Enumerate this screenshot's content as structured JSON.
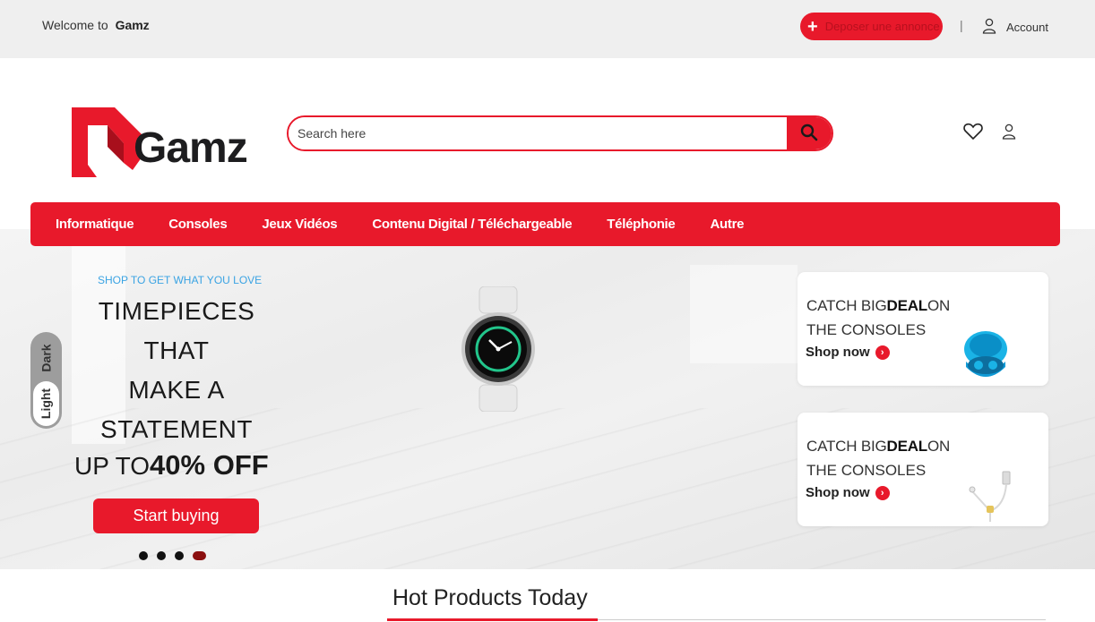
{
  "topbar": {
    "welcome_text": "Welcome to",
    "brand_name": "Gamz",
    "post_ad_label": "Deposer une annonce",
    "separator": "|",
    "account_label": "Account"
  },
  "header": {
    "logo_text": "Gamz",
    "search": {
      "placeholder": "Search here",
      "value": ""
    }
  },
  "nav": {
    "items": [
      {
        "label": "Informatique"
      },
      {
        "label": "Consoles"
      },
      {
        "label": "Jeux Vidéos"
      },
      {
        "label": "Contenu Digital / Téléchargeable"
      },
      {
        "label": "Téléphonie"
      },
      {
        "label": "Autre"
      }
    ]
  },
  "hero": {
    "tagline": "SHOP TO GET WHAT YOU LOVE",
    "headline_lines": [
      "TIMEPIECES",
      "THAT",
      "MAKE A",
      "STATEMENT"
    ],
    "discount_prefix": "UP TO",
    "discount_value": "40% OFF",
    "cta_label": "Start buying",
    "slides_count": 4,
    "active_slide": 4
  },
  "theme_toggle": {
    "dark_label": "Dark",
    "light_label": "Light",
    "selected": "Light"
  },
  "promos": [
    {
      "pre": "CATCH BIG",
      "bold": "DEAL",
      "post": "ON",
      "line2": "THE CONSOLES",
      "shop_label": "Shop now",
      "image": "earbuds-case"
    },
    {
      "pre": "CATCH BIG",
      "bold": "DEAL",
      "post": "ON",
      "line2": "THE CONSOLES",
      "shop_label": "Shop now",
      "image": "usb-earphones"
    }
  ],
  "section": {
    "title": "Hot Products Today"
  },
  "colors": {
    "accent": "#e8192b",
    "topbar_bg": "#efefef",
    "tagline": "#3aa3e3"
  }
}
